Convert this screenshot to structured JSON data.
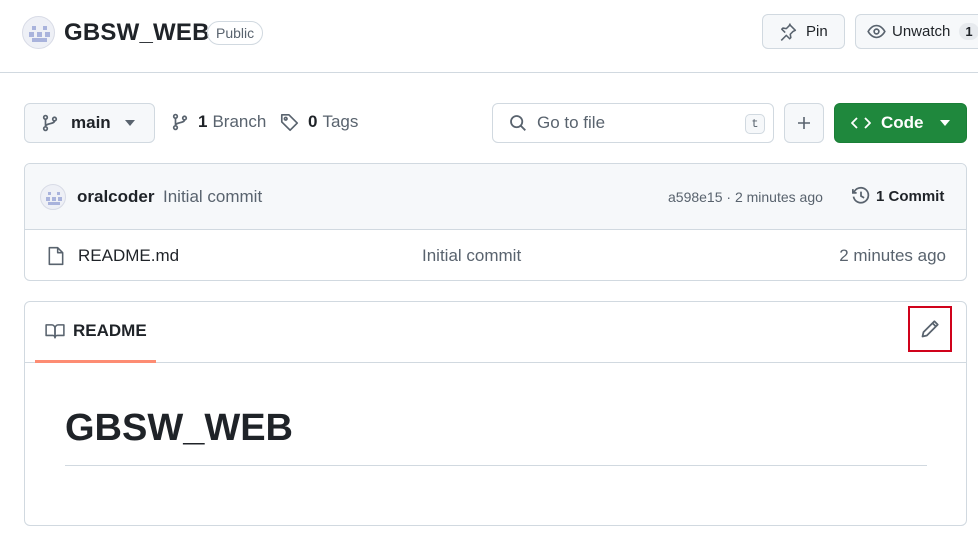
{
  "repo": {
    "name": "GBSW_WEB",
    "visibility": "Public"
  },
  "header_actions": {
    "pin_label": "Pin",
    "unwatch_label": "Unwatch",
    "watch_count": "1"
  },
  "toolbar": {
    "branch": "main",
    "branches_count": "1",
    "branches_label": "Branch",
    "tags_count": "0",
    "tags_label": "Tags",
    "goto_placeholder": "Go to file",
    "goto_shortcut": "t",
    "code_label": "Code"
  },
  "latest_commit": {
    "author": "oralcoder",
    "message": "Initial commit",
    "sha_time": "a598e15 · 2 minutes ago",
    "commits_label": "1 Commit"
  },
  "files": [
    {
      "name": "README.md",
      "commit_message": "Initial commit",
      "age": "2 minutes ago"
    }
  ],
  "readme": {
    "tab_label": "README",
    "title": "GBSW_WEB"
  },
  "colors": {
    "code_button": "#1f883d",
    "tab_underline": "#fd8c73",
    "highlight_box": "#d0021b"
  },
  "icons": [
    "repo-avatar",
    "pin-icon",
    "eye-icon",
    "git-branch-icon",
    "tag-icon",
    "search-icon",
    "plus-icon",
    "code-icon",
    "history-icon",
    "file-icon",
    "book-icon",
    "pencil-icon"
  ]
}
